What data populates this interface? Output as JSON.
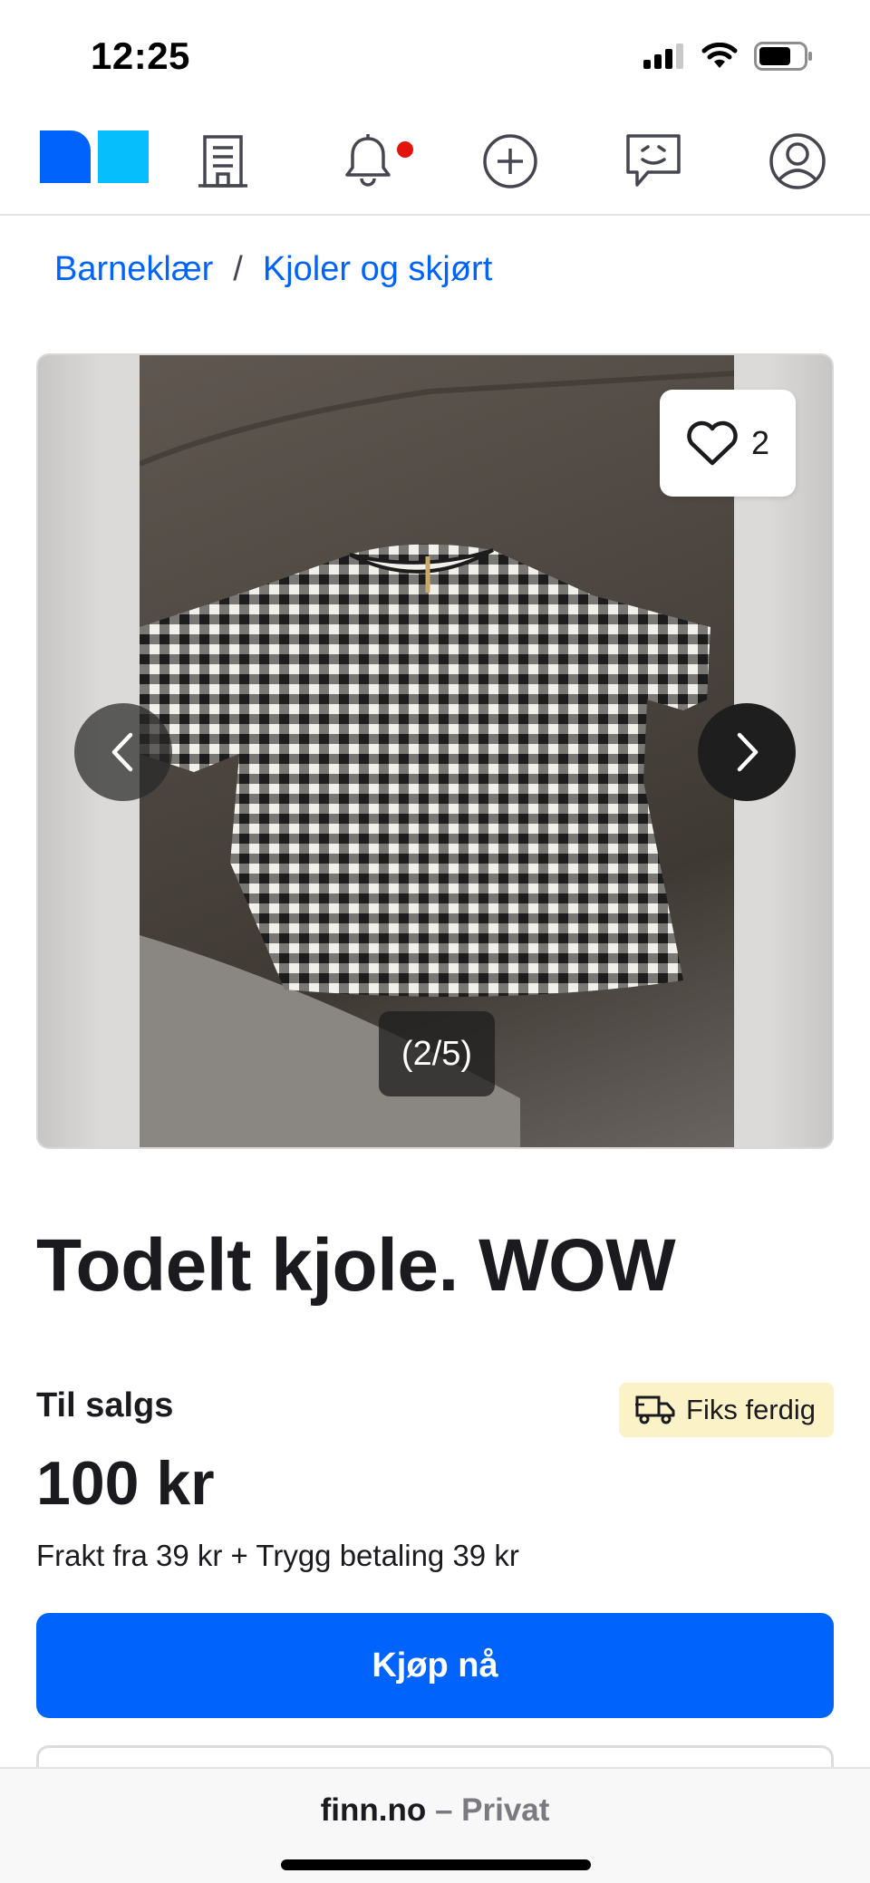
{
  "status_bar": {
    "time": "12:25",
    "icons": [
      "cellular-signal-icon",
      "wifi-icon",
      "battery-icon"
    ]
  },
  "top_nav": {
    "items": [
      {
        "name": "finn-logo",
        "icon": "finn-logo-icon"
      },
      {
        "name": "nav-jobs",
        "icon": "building-icon"
      },
      {
        "name": "nav-notifications",
        "icon": "bell-icon",
        "has_unread": true
      },
      {
        "name": "nav-new-ad",
        "icon": "plus-circle-icon"
      },
      {
        "name": "nav-messages",
        "icon": "chat-bubble-icon"
      },
      {
        "name": "nav-profile",
        "icon": "user-circle-icon"
      }
    ],
    "colors": {
      "logo_dark": "#0063fb",
      "logo_light": "#06befb",
      "notification_dot": "#e3140c"
    }
  },
  "breadcrumb": {
    "items": [
      "Barneklær",
      "Kjoler og skjørt"
    ],
    "separator": "/"
  },
  "gallery": {
    "favorite_count": "2",
    "counter": "(2/5)",
    "icons": [
      "heart-icon",
      "chevron-left-icon",
      "chevron-right-icon"
    ]
  },
  "ad": {
    "title": "Todelt kjole. WOW",
    "status_label": "Til salgs",
    "badge": {
      "label": "Fiks ferdig",
      "icon": "truck-icon",
      "color": "#fbf3c7"
    },
    "price": "100 kr",
    "shipping_text": "Frakt fra 39 kr + Trygg betaling 39 kr",
    "buy_label": "Kjøp nå",
    "accent_color": "#0063fb"
  },
  "browser_bar": {
    "domain": "finn.no",
    "suffix": "– Privat"
  }
}
